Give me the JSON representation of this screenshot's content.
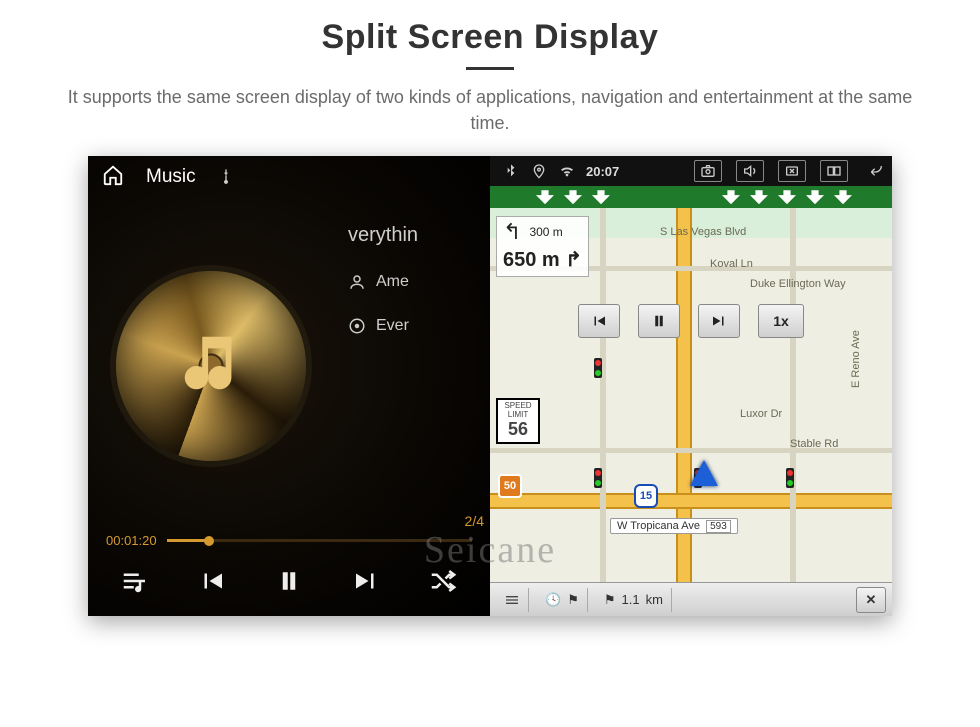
{
  "page": {
    "title": "Split Screen Display",
    "subtitle": "It supports the same screen display of two kinds of applications, navigation and entertainment at the same time."
  },
  "music": {
    "topbar_label": "Music",
    "track_title_partial": "verythin",
    "artist_partial": "Ame",
    "album_partial": "Ever",
    "counter": "2/4",
    "elapsed": "00:01:20",
    "progress_percent": 14
  },
  "statusbar": {
    "time": "20:07"
  },
  "nav": {
    "turn_small_distance": "300 m",
    "turn_big_distance": "650 m",
    "speed_limit_label_top": "SPEED",
    "speed_limit_label_bottom": "LIMIT",
    "speed_limit_value": "56",
    "route_badge_1": "50",
    "route_badge_2": "15",
    "sim_speed": "1x",
    "streets": {
      "s_las_vegas": "S Las Vegas Blvd",
      "koval": "Koval Ln",
      "duke": "Duke Ellington Way",
      "luxor": "Luxor Dr",
      "stable": "Stable Rd",
      "reno": "E Reno Ave",
      "tropicana": "W Tropicana Ave",
      "tropicana_num": "593"
    },
    "footer": {
      "eta_flag": "⚑",
      "time_icon": "⏱",
      "dist_value": "1.1",
      "dist_unit": "km"
    }
  },
  "watermark": "Seicane"
}
